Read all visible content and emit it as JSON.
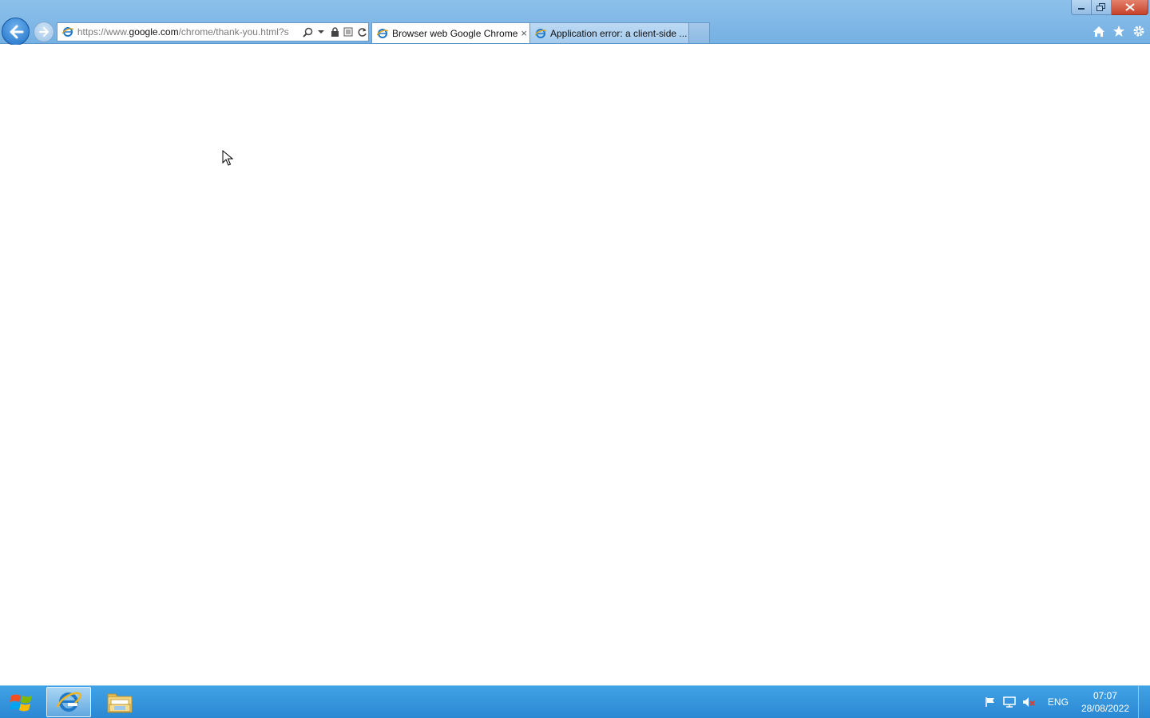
{
  "window": {
    "minimize_icon": "minimize-icon",
    "maximize_icon": "restore-icon",
    "close_icon": "close-icon"
  },
  "navigation": {
    "back_icon": "back-arrow-icon",
    "forward_icon": "forward-arrow-icon"
  },
  "address_bar": {
    "url_scheme": "https://www.",
    "url_domain": "google.com",
    "url_rest": "/chrome/thank-you.html?s",
    "tools": [
      "search-icon",
      "dropdown-icon",
      "lock-icon",
      "compatibility-icon",
      "refresh-icon"
    ]
  },
  "tabs": [
    {
      "label": "Browser web Google Chrome",
      "active": true,
      "close": "×"
    },
    {
      "label": "Application error: a client-side ...",
      "active": false
    }
  ],
  "toolbar_right": [
    "home-icon",
    "favorites-star-icon",
    "settings-gear-icon"
  ],
  "taskbar": {
    "pinned": [
      "internet-explorer-icon",
      "file-explorer-icon"
    ],
    "tray_icons": [
      "action-center-flag-icon",
      "network-icon",
      "volume-muted-icon"
    ],
    "language": "ENG",
    "time": "07:07",
    "date": "28/08/2022"
  },
  "colors": {
    "chrome_top": "#8cc0ea",
    "taskbar": "#2a88d3",
    "close_button": "#c7432a"
  }
}
